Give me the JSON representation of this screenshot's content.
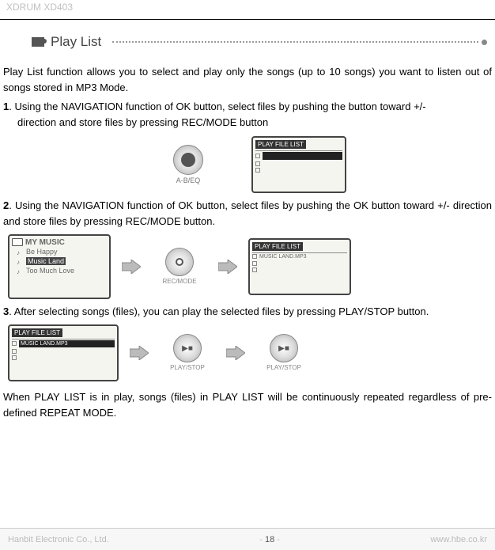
{
  "header": {
    "product_line": "XDRUM XD403"
  },
  "playlist": {
    "title": "Play List"
  },
  "content": {
    "intro": "Play List function allows you to select and play only the songs (up to 10 songs) you want to listen out of songs stored in MP3 Mode.",
    "step1_num": "1",
    "step1_a": ". Using the NAVIGATION function of OK button, select files by pushing the button toward ",
    "step1_plus": "+/-",
    "step1_b": "direction and store files by pressing REC/MODE button",
    "step2_num": "2",
    "step2_a": ". Using the NAVIGATION function of OK button, select files by pushing the OK button toward +/- direction and store files by pressing REC/MODE button.",
    "step3_num": "3",
    "step3_a": ". After selecting songs (files), you can play the selected files by pressing PLAY/STOP button.",
    "footnote": "When PLAY LIST is in play, songs (files) in PLAY LIST will be continuously repeated regardless of pre-defined REPEAT MODE."
  },
  "labels": {
    "abeq": "A-B/EQ",
    "recmode": "REC/MODE",
    "playstop": "PLAY/STOP"
  },
  "screens": {
    "playfilelist": "PLAY FILE LIST",
    "mymusic": "MY MUSIC",
    "song1": "Be Happy",
    "song2": "Music Land",
    "song3": "Too Much Love",
    "file_sel": "MUSIC LAND.MP3"
  },
  "footer": {
    "company": "Hanbit Electronic Co., Ltd.",
    "page_prefix": "- ",
    "page_num": "18",
    "page_suffix": " -",
    "url": "www.hbe.co.kr"
  }
}
